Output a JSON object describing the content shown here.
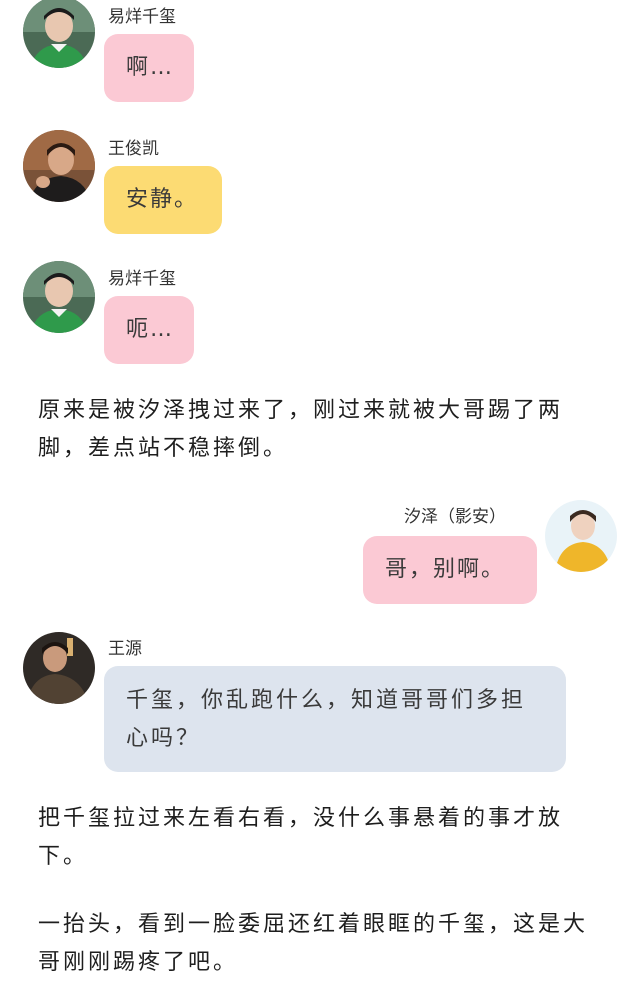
{
  "messages": [
    {
      "speaker": "易烊千玺",
      "text": "啊…"
    },
    {
      "speaker": "王俊凯",
      "text": "安静。"
    },
    {
      "speaker": "易烊千玺",
      "text": "呃…"
    },
    {
      "speaker": "汐泽（影安）",
      "text": "哥，别啊。"
    },
    {
      "speaker": "王源",
      "text": "千玺，你乱跑什么，知道哥哥们多担心吗？"
    }
  ],
  "narration": [
    "原来是被汐泽拽过来了，刚过来就被大哥踢了两脚，差点站不稳摔倒。",
    "把千玺拉过来左看右看，没什么事悬着的事才放下。",
    "一抬头，看到一脸委屈还红着眼眶的千玺，这是大哥刚刚踢疼了吧。"
  ],
  "colors": {
    "bubble_pink": "#fbc9d4",
    "bubble_yellow": "#fcdb73",
    "bubble_blue": "#dde4ee",
    "background": "#ffffff"
  },
  "icons": {
    "avatar_qianxi": "avatar-photo",
    "avatar_junkai": "avatar-photo",
    "avatar_xize": "avatar-photo",
    "avatar_wangyuan": "avatar-photo"
  }
}
